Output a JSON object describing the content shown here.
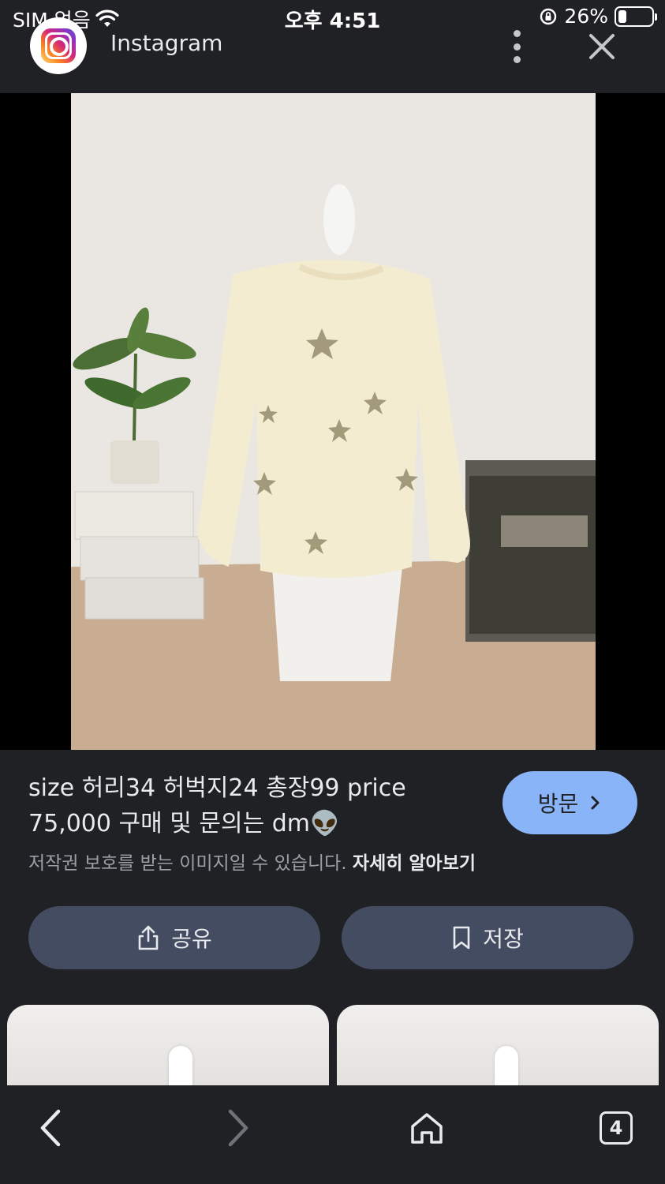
{
  "status_bar": {
    "carrier": "SIM 없음",
    "time": "오후 4:51",
    "battery_percent": "26%",
    "battery_level": 0.26
  },
  "header": {
    "app_icon": "instagram-logo",
    "title": "Instagram",
    "more_icon": "more-vert-icon",
    "close_icon": "close-icon"
  },
  "image": {
    "description_icon": "product-photo"
  },
  "info": {
    "caption_line1": "size 허리34 허벅지24 총장99 price",
    "caption_line2": "75,000 구매 및 문의는 dm👽",
    "visit_label": "방문",
    "copyright_text": "저작권 보호를 받는 이미지일 수 있습니다.",
    "learn_more": "자세히 알아보기"
  },
  "actions": {
    "share_label": "공유",
    "save_label": "저장"
  },
  "bottom_nav": {
    "tab_count": "4"
  },
  "colors": {
    "background": "#202124",
    "accent": "#8ab4f8",
    "action_button": "#434c61"
  }
}
